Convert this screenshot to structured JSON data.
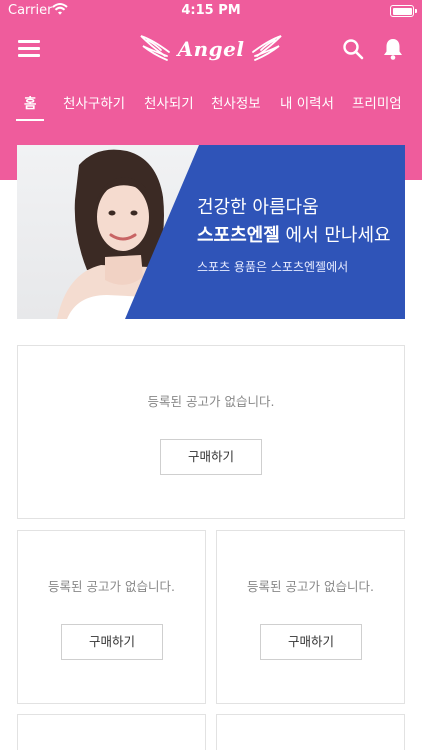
{
  "status_bar": {
    "carrier": "Carrier",
    "time": "4:15 PM"
  },
  "header": {
    "logo_text": "Angel"
  },
  "tabs": [
    {
      "label": "홈",
      "active": true
    },
    {
      "label": "천사구하기",
      "active": false
    },
    {
      "label": "천사되기",
      "active": false
    },
    {
      "label": "천사정보",
      "active": false
    },
    {
      "label": "내 이력서",
      "active": false
    },
    {
      "label": "프리미엄",
      "active": false
    }
  ],
  "banner": {
    "line1": "건강한 아름다움",
    "brand": "스포츠엔젤",
    "line2_rest": " 에서 만나세요",
    "line3": "스포츠 용품은 스포츠엔젤에서"
  },
  "cards": [
    {
      "message": "등록된 공고가 없습니다.",
      "button": "구매하기"
    },
    {
      "message": "등록된 공고가 없습니다.",
      "button": "구매하기"
    },
    {
      "message": "등록된 공고가 없습니다.",
      "button": "구매하기"
    }
  ],
  "colors": {
    "header_pink": "#ef5c9c",
    "banner_blue": "#2f54b8"
  }
}
